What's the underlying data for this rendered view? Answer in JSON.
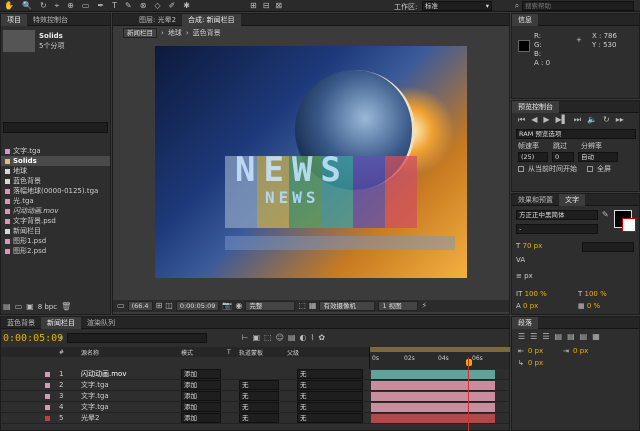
{
  "menu": {
    "workspace_label": "工作区:",
    "workspace_value": "标准",
    "search_placeholder": "搜索帮助"
  },
  "project": {
    "tabs": [
      "项目",
      "特效控制台"
    ],
    "selected_name": "Solids",
    "selected_info": "5个分项",
    "items": [
      {
        "name": "文字.tga",
        "color": "#d69ab8"
      },
      {
        "name": "Solids",
        "color": "#e0c070",
        "bold": true
      },
      {
        "name": "地球",
        "color": "#d8d8d8"
      },
      {
        "name": "蓝色背景",
        "color": "#d8d8d8"
      },
      {
        "name": "落幅地球(0000-0125).tga",
        "color": "#d69ab8"
      },
      {
        "name": "光.tga",
        "color": "#d69ab8"
      },
      {
        "name": "闪动动画.mov",
        "color": "#d69ab8"
      },
      {
        "name": "文字背景.psd",
        "color": "#d69ab8"
      },
      {
        "name": "新闻栏目",
        "color": "#d8d8d8"
      },
      {
        "name": "图形1.psd",
        "color": "#d69ab8"
      },
      {
        "name": "图形2.psd",
        "color": "#d69ab8"
      }
    ],
    "bpc": "8 bpc"
  },
  "viewer": {
    "tabs": [
      "图层: 光晕2",
      "合成: 新闻栏目"
    ],
    "breadcrumbs": [
      "新闻栏目",
      "地球",
      "蓝色背景"
    ],
    "news_text": "NEWS",
    "zoom": "(66.4",
    "timecode": "0:00:05:09",
    "resolution": "完整",
    "camera": "有效摄像机",
    "views": "1 视图"
  },
  "info": {
    "title": "信息",
    "r": "R:",
    "g": "G:",
    "b": "B:",
    "a": "A : 0",
    "x": "X : 786",
    "y": "Y : 530"
  },
  "preview": {
    "title": "预览控制台",
    "ram_label": "RAM 预览选项",
    "frame_rate_label": "帧速率",
    "skip_label": "跳过",
    "resolution_label": "分辨率",
    "frame_rate_value": "(25)",
    "skip_value": "0",
    "resolution_value": "自动",
    "from_current": "从当前时间开始",
    "fullscreen": "全屏"
  },
  "character": {
    "tabs": [
      "效果和预置",
      "文字"
    ],
    "font": "方正正中黑简体",
    "font_style": "-",
    "size": "70 px",
    "leading_unit": "px",
    "scale_v": "100 %",
    "scale_h": "100 %",
    "baseline": "0 px",
    "tsume": "0 %"
  },
  "paragraph": {
    "title": "段落",
    "indent1": "0 px",
    "indent2": "0 px",
    "indent3": "0 px"
  },
  "timeline": {
    "tabs": [
      "蓝色背景",
      "新闻栏目",
      "渲染队列"
    ],
    "timecode": "0:00:05:09",
    "search_placeholder": "",
    "col_num": "#",
    "col_source": "源名称",
    "col_mode": "模式",
    "col_t": "T",
    "col_trkmat": "轨道蒙板",
    "col_parent": "父级",
    "ruler": [
      "0s",
      "02s",
      "04s",
      "06s"
    ],
    "layers": [
      {
        "num": "1",
        "name": "闪动动画.mov",
        "mode": "添加",
        "trk": "",
        "parent": "无",
        "color": "#d69ab8",
        "bar": "#5fa39a"
      },
      {
        "num": "2",
        "name": "文字.tga",
        "mode": "添加",
        "trk": "无",
        "parent": "无",
        "color": "#d69ab8",
        "bar": "#c98e9e"
      },
      {
        "num": "3",
        "name": "文字.tga",
        "mode": "添加",
        "trk": "无",
        "parent": "无",
        "color": "#d69ab8",
        "bar": "#c98e9e"
      },
      {
        "num": "4",
        "name": "文字.tga",
        "mode": "添加",
        "trk": "无",
        "parent": "无",
        "color": "#d69ab8",
        "bar": "#c98e9e"
      },
      {
        "num": "5",
        "name": "光晕2",
        "mode": "添加",
        "trk": "无",
        "parent": "无",
        "color": "#c04040",
        "bar": "#b44848"
      }
    ]
  },
  "colors": {
    "accent": "#e8b000",
    "playhead": "#d03030"
  }
}
